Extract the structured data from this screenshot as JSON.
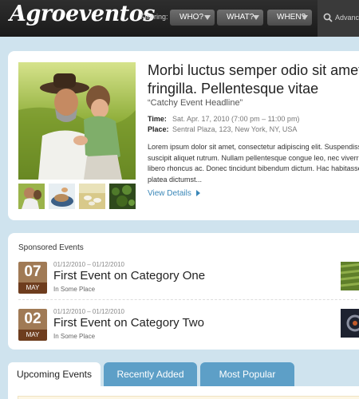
{
  "header": {
    "logo": "Agroeventos",
    "filter_label": "Filtering:",
    "filters": [
      {
        "label": "WHO?"
      },
      {
        "label": "WHAT?"
      },
      {
        "label": "WHEN?"
      }
    ],
    "search_placeholder": "Advanced"
  },
  "featured": {
    "title": "Morbi luctus semper odio sit amet fringilla. Pellentesque vitae",
    "subtitle": "“Catchy Event Headline”",
    "time_label": "Time:",
    "time_value": "Sat. Apr. 17, 2010 (7:00 pm – 11:00 pm)",
    "place_label": "Place:",
    "place_value": "Sentral Plaza, 123, New York, NY, USA",
    "description": "Lorem ipsum dolor sit amet, consectetur adipiscing elit. Suspendisse suscipit aliquet rutrum. Nullam pellentesque congue leo, nec viverra libero rhoncus ac. Donec tincidunt bibendum dictum. Hac habitasse platea dictumst...",
    "view_details": "View Details"
  },
  "sponsored": {
    "title": "Sponsored Events",
    "events": [
      {
        "day": "07",
        "month": "MAY",
        "dates": "01/12/2010 – 01/12/2010",
        "name": "First Event on Category One",
        "place": "In Some Place"
      },
      {
        "day": "02",
        "month": "MAY",
        "dates": "01/12/2010 – 01/12/2010",
        "name": "First Event on Category Two",
        "place": "In Some Place"
      }
    ]
  },
  "tabs": [
    {
      "label": "Upcoming Events",
      "active": true
    },
    {
      "label": "Recently Added",
      "active": false
    },
    {
      "label": "Most Popular",
      "active": false
    }
  ],
  "colors": {
    "header_bg": "#1f1f1f",
    "page_bg": "#cfe3ee",
    "link": "#3a87b8",
    "tab_inactive": "#5d9fc7",
    "date_day": "#a07a55",
    "date_month": "#6e3d1e"
  }
}
